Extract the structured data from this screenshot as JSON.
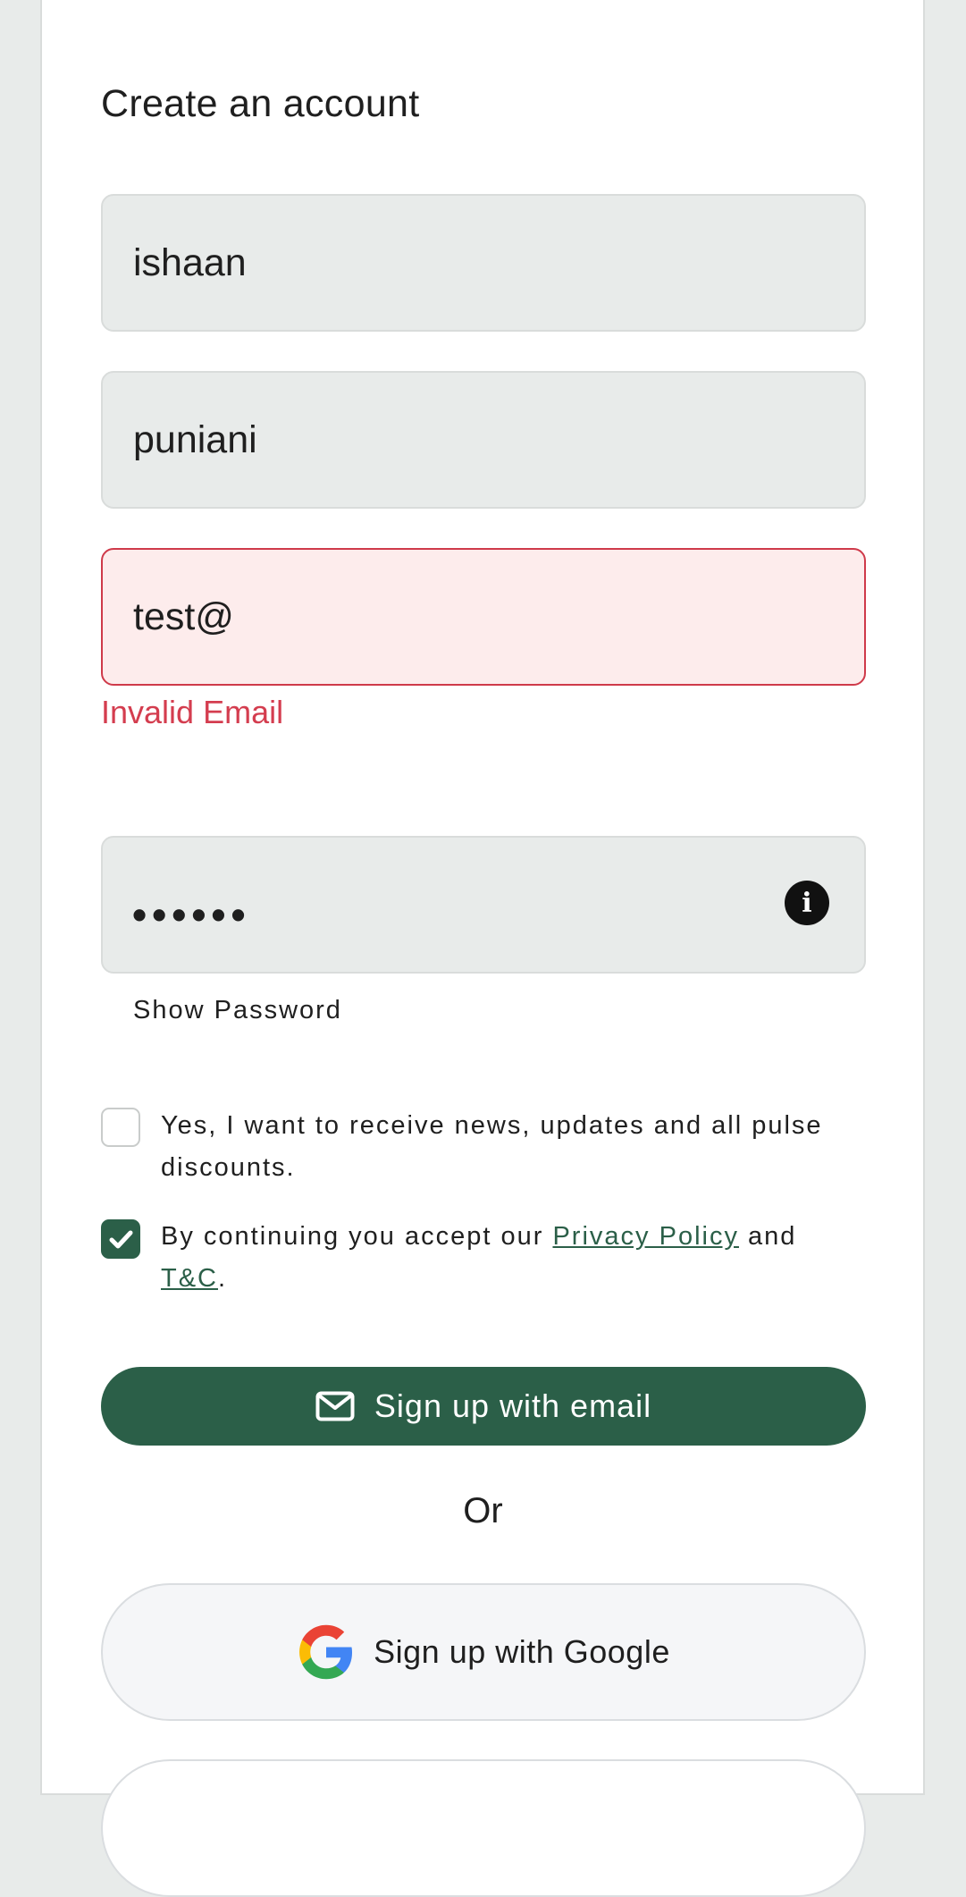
{
  "form": {
    "title": "Create an account",
    "first_name": {
      "value": "ishaan"
    },
    "last_name": {
      "value": "puniani"
    },
    "email": {
      "value": "test@",
      "error": "Invalid Email"
    },
    "password": {
      "masked": "••••••",
      "info_icon": "info-icon"
    },
    "show_password_label": "Show Password",
    "newsletter": {
      "checked": false,
      "label": "Yes, I want to receive news, updates and all pulse discounts."
    },
    "terms": {
      "checked": true,
      "prefix": "By continuing you accept our",
      "privacy_link": "Privacy Policy",
      "and": "and",
      "tc_link": "T&C",
      "suffix": "."
    },
    "email_signup_label": "Sign up with email",
    "or_label": "Or",
    "google_signup_label": "Sign up with Google"
  },
  "colors": {
    "primary": "#2b5f48",
    "error": "#d43d4f",
    "error_bg": "#fdecec",
    "field_bg": "#e8ebea"
  }
}
